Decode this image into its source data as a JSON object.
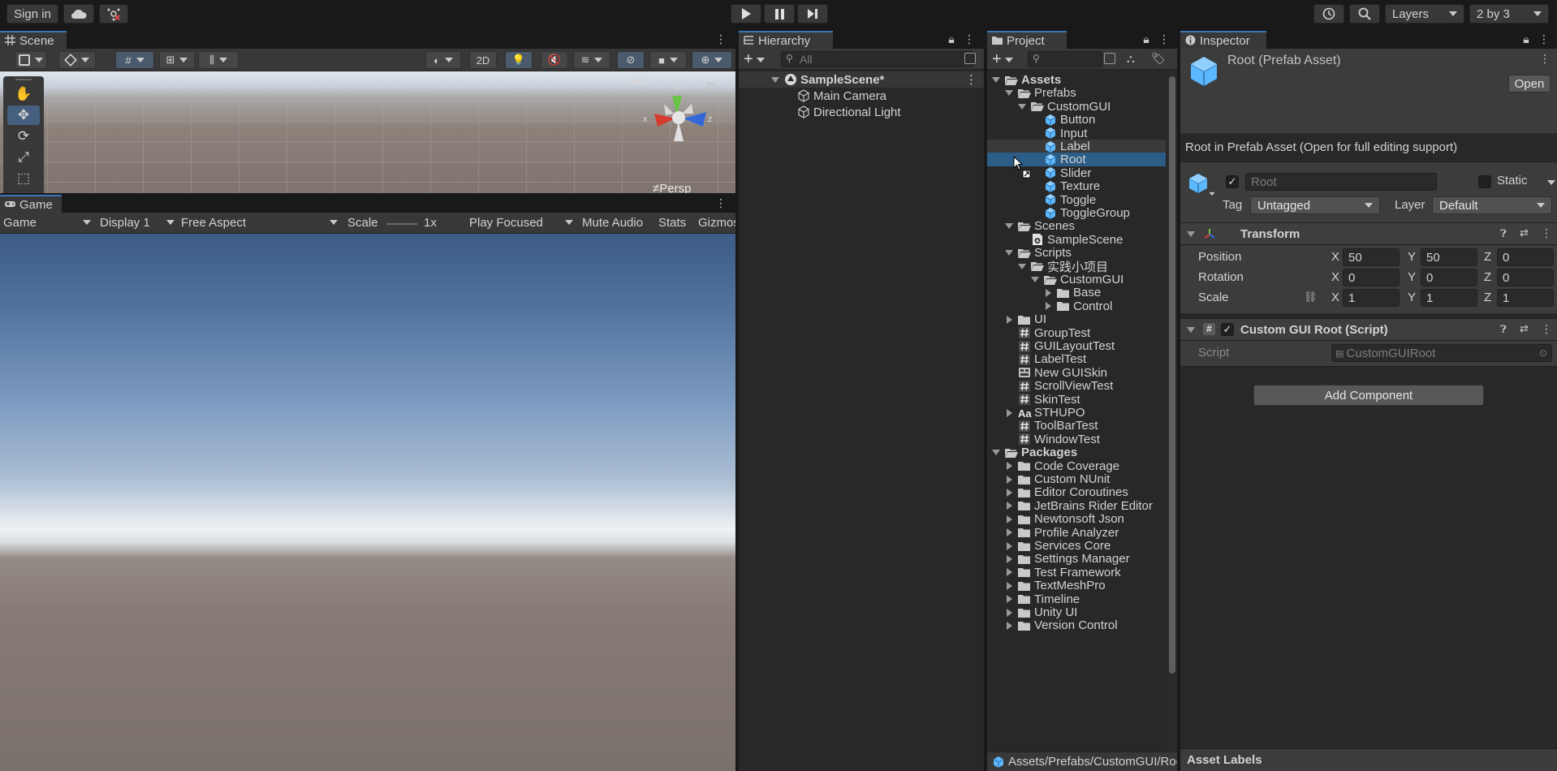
{
  "toolbar": {
    "sign_in": "Sign in",
    "layers": "Layers",
    "layout": "2 by 3"
  },
  "scene": {
    "tab": "Scene",
    "toggle_2d": "2D",
    "persp": "≠Persp",
    "axis_x": "x",
    "axis_z": "z",
    "axis_y": "y"
  },
  "game": {
    "tab": "Game",
    "view_select": "Game",
    "display": "Display 1",
    "aspect": "Free Aspect",
    "scale_label": "Scale",
    "scale_value": "1x",
    "play_mode": "Play Focused",
    "mute": "Mute Audio",
    "stats": "Stats",
    "gizmos": "Gizmos"
  },
  "hierarchy": {
    "tab": "Hierarchy",
    "search_placeholder": "All",
    "scene_name": "SampleScene*",
    "items": [
      "Main Camera",
      "Directional Light"
    ]
  },
  "project": {
    "tab": "Project",
    "path": "Assets/Prefabs/CustomGUI/Root.prefab",
    "rows": [
      {
        "label": "Assets",
        "level": 0,
        "arrow": "down",
        "icon": "folder-open",
        "bold": true
      },
      {
        "label": "Prefabs",
        "level": 1,
        "arrow": "down",
        "icon": "folder-open"
      },
      {
        "label": "CustomGUI",
        "level": 2,
        "arrow": "down",
        "icon": "folder-open"
      },
      {
        "label": "Button",
        "level": 3,
        "arrow": "none",
        "icon": "prefab"
      },
      {
        "label": "Input",
        "level": 3,
        "arrow": "none",
        "icon": "prefab"
      },
      {
        "label": "Label",
        "level": 3,
        "arrow": "none",
        "icon": "prefab",
        "hover": true
      },
      {
        "label": "Root",
        "level": 3,
        "arrow": "none",
        "icon": "prefab",
        "selected": true
      },
      {
        "label": "Slider",
        "level": 3,
        "arrow": "none",
        "icon": "prefab"
      },
      {
        "label": "Texture",
        "level": 3,
        "arrow": "none",
        "icon": "prefab"
      },
      {
        "label": "Toggle",
        "level": 3,
        "arrow": "none",
        "icon": "prefab"
      },
      {
        "label": "ToggleGroup",
        "level": 3,
        "arrow": "none",
        "icon": "prefab"
      },
      {
        "label": "Scenes",
        "level": 1,
        "arrow": "down",
        "icon": "folder-open"
      },
      {
        "label": "SampleScene",
        "level": 2,
        "arrow": "none",
        "icon": "scene"
      },
      {
        "label": "Scripts",
        "level": 1,
        "arrow": "down",
        "icon": "folder-open"
      },
      {
        "label": "实践小项目",
        "level": 2,
        "arrow": "down",
        "icon": "folder-open"
      },
      {
        "label": "CustomGUI",
        "level": 3,
        "arrow": "down",
        "icon": "folder-open"
      },
      {
        "label": "Base",
        "level": 4,
        "arrow": "right",
        "icon": "folder"
      },
      {
        "label": "Control",
        "level": 4,
        "arrow": "right",
        "icon": "folder"
      },
      {
        "label": "UI",
        "level": 1,
        "arrow": "right",
        "icon": "folder"
      },
      {
        "label": "GroupTest",
        "level": 1,
        "arrow": "none",
        "icon": "script"
      },
      {
        "label": "GUILayoutTest",
        "level": 1,
        "arrow": "none",
        "icon": "script"
      },
      {
        "label": "LabelTest",
        "level": 1,
        "arrow": "none",
        "icon": "script"
      },
      {
        "label": "New GUISkin",
        "level": 1,
        "arrow": "none",
        "icon": "guiskin"
      },
      {
        "label": "ScrollViewTest",
        "level": 1,
        "arrow": "none",
        "icon": "script"
      },
      {
        "label": "SkinTest",
        "level": 1,
        "arrow": "none",
        "icon": "script"
      },
      {
        "label": "STHUPO",
        "level": 1,
        "arrow": "right",
        "icon": "font"
      },
      {
        "label": "ToolBarTest",
        "level": 1,
        "arrow": "none",
        "icon": "script"
      },
      {
        "label": "WindowTest",
        "level": 1,
        "arrow": "none",
        "icon": "script"
      },
      {
        "label": "Packages",
        "level": 0,
        "arrow": "down",
        "icon": "folder-open",
        "bold": true
      },
      {
        "label": "Code Coverage",
        "level": 1,
        "arrow": "right",
        "icon": "folder"
      },
      {
        "label": "Custom NUnit",
        "level": 1,
        "arrow": "right",
        "icon": "folder"
      },
      {
        "label": "Editor Coroutines",
        "level": 1,
        "arrow": "right",
        "icon": "folder"
      },
      {
        "label": "JetBrains Rider Editor",
        "level": 1,
        "arrow": "right",
        "icon": "folder"
      },
      {
        "label": "Newtonsoft Json",
        "level": 1,
        "arrow": "right",
        "icon": "folder"
      },
      {
        "label": "Profile Analyzer",
        "level": 1,
        "arrow": "right",
        "icon": "folder"
      },
      {
        "label": "Services Core",
        "level": 1,
        "arrow": "right",
        "icon": "folder"
      },
      {
        "label": "Settings Manager",
        "level": 1,
        "arrow": "right",
        "icon": "folder"
      },
      {
        "label": "Test Framework",
        "level": 1,
        "arrow": "right",
        "icon": "folder"
      },
      {
        "label": "TextMeshPro",
        "level": 1,
        "arrow": "right",
        "icon": "folder"
      },
      {
        "label": "Timeline",
        "level": 1,
        "arrow": "right",
        "icon": "folder"
      },
      {
        "label": "Unity UI",
        "level": 1,
        "arrow": "right",
        "icon": "folder"
      },
      {
        "label": "Version Control",
        "level": 1,
        "arrow": "right",
        "icon": "folder"
      }
    ]
  },
  "inspector": {
    "tab": "Inspector",
    "title": "Root (Prefab Asset)",
    "open_button": "Open",
    "notice": "Root in Prefab Asset (Open for full editing support)",
    "object_name": "Root",
    "static_label": "Static",
    "tag_label": "Tag",
    "tag_value": "Untagged",
    "layer_label": "Layer",
    "layer_value": "Default",
    "transform": {
      "title": "Transform",
      "position_label": "Position",
      "rotation_label": "Rotation",
      "scale_label": "Scale",
      "position": {
        "x": "50",
        "y": "50",
        "z": "0"
      },
      "rotation": {
        "x": "0",
        "y": "0",
        "z": "0"
      },
      "scale": {
        "x": "1",
        "y": "1",
        "z": "1"
      }
    },
    "script_component": {
      "title": "Custom GUI Root (Script)",
      "script_label": "Script",
      "script_value": "CustomGUIRoot"
    },
    "add_component": "Add Component",
    "asset_labels": "Asset Labels"
  },
  "colors": {
    "selection": "#2c5d87",
    "accent": "#3a79bb",
    "panel": "#282828",
    "prefab_icon": "#5cb8ff"
  }
}
